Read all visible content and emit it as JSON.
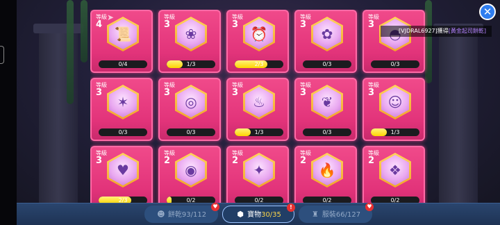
{
  "level_label": "等級",
  "cards": [
    {
      "level": "4",
      "icon": "treasure-scroll-icon",
      "glyph": "📜",
      "progress": "0/4",
      "fill": 0
    },
    {
      "level": "3",
      "icon": "treasure-lace-icon",
      "glyph": "❀",
      "progress": "1/3",
      "fill": 0.333
    },
    {
      "level": "3",
      "icon": "treasure-alarm-clock-icon",
      "glyph": "⏰",
      "progress": "2/3",
      "fill": 0.667
    },
    {
      "level": "3",
      "icon": "treasure-flower-icon",
      "glyph": "✿",
      "progress": "0/3",
      "fill": 0
    },
    {
      "level": "3",
      "icon": "treasure-hat-icon",
      "glyph": "◓",
      "progress": "0/3",
      "fill": 0
    },
    {
      "level": "3",
      "icon": "treasure-shuriken-icon",
      "glyph": "✶",
      "progress": "0/3",
      "fill": 0
    },
    {
      "level": "3",
      "icon": "treasure-swirl-icon",
      "glyph": "◎",
      "progress": "0/3",
      "fill": 0
    },
    {
      "level": "3",
      "icon": "treasure-flamingo-icon",
      "glyph": "♨",
      "progress": "1/3",
      "fill": 0.333
    },
    {
      "level": "3",
      "icon": "treasure-branch-icon",
      "glyph": "❦",
      "progress": "0/3",
      "fill": 0
    },
    {
      "level": "3",
      "icon": "treasure-mask-icon",
      "glyph": "☺",
      "progress": "1/3",
      "fill": 0.333
    },
    {
      "level": "3",
      "icon": "treasure-bag-icon",
      "glyph": "♥",
      "progress": "2/3",
      "fill": 0.667
    },
    {
      "level": "2",
      "icon": "treasure-locket-icon",
      "glyph": "◉",
      "progress": "0/2",
      "fill": 0.1
    },
    {
      "level": "2",
      "icon": "treasure-compass-icon",
      "glyph": "✦",
      "progress": "0/2",
      "fill": 0
    },
    {
      "level": "2",
      "icon": "treasure-torch-icon",
      "glyph": "🔥",
      "progress": "0/2",
      "fill": 0
    },
    {
      "level": "2",
      "icon": "treasure-blue-bag-icon",
      "glyph": "❖",
      "progress": "0/2",
      "fill": 0
    }
  ],
  "notice": {
    "player": "[VJDRAL6927]獲得",
    "item": "[黃金起司餅乾]"
  },
  "tabs": [
    {
      "label": "餅乾",
      "count": "93/112",
      "icon": "cookie-icon",
      "glyph": "☻"
    },
    {
      "label": "寶物",
      "count": "30/35",
      "icon": "treasure-icon",
      "glyph": "⬢"
    },
    {
      "label": "服裝",
      "count": "66/127",
      "icon": "costume-icon",
      "glyph": "♜"
    }
  ],
  "close_glyph": "✕",
  "share_glyph": "➤",
  "badge_heart": "♥",
  "badge_alert": "!"
}
